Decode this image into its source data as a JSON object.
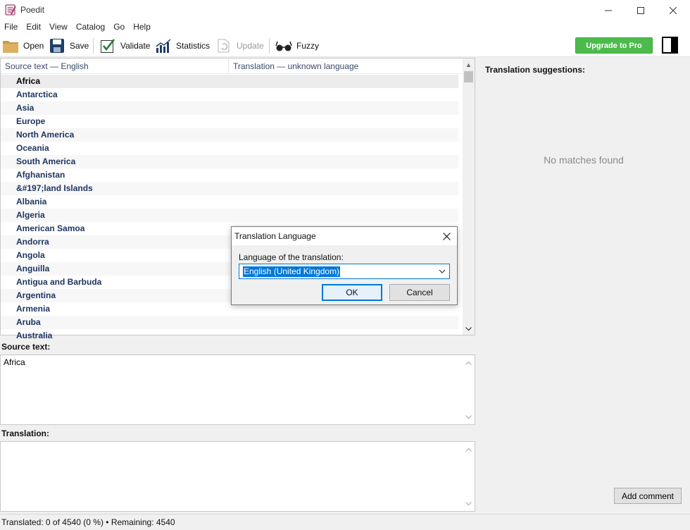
{
  "window": {
    "title": "Poedit"
  },
  "menu": [
    "File",
    "Edit",
    "View",
    "Catalog",
    "Go",
    "Help"
  ],
  "toolbar": {
    "open": "Open",
    "save": "Save",
    "validate": "Validate",
    "statistics": "Statistics",
    "update": "Update",
    "fuzzy": "Fuzzy",
    "upgrade": "Upgrade to Pro"
  },
  "list": {
    "col_source": "Source text — English",
    "col_translation": "Translation — unknown language",
    "rows": [
      "Africa",
      "Antarctica",
      "Asia",
      "Europe",
      "North America",
      "Oceania",
      "South America",
      "Afghanistan",
      "&#197;land Islands",
      "Albania",
      "Algeria",
      "American Samoa",
      "Andorra",
      "Angola",
      "Anguilla",
      "Antigua and Barbuda",
      "Argentina",
      "Armenia",
      "Aruba",
      "Australia"
    ],
    "selected_index": 0
  },
  "source_pane": {
    "label": "Source text:",
    "text": "Africa"
  },
  "translation_pane": {
    "label": "Translation:",
    "text": ""
  },
  "suggestions": {
    "title": "Translation suggestions:",
    "empty": "No matches found",
    "add_comment": "Add comment"
  },
  "status": "Translated: 0 of 4540 (0 %)  •  Remaining: 4540",
  "dialog": {
    "title": "Translation Language",
    "label": "Language of the translation:",
    "selected": "English (United Kingdom)",
    "ok": "OK",
    "cancel": "Cancel"
  },
  "colors": {
    "upgrade_bg": "#4cbb4c",
    "accent": "#0078d7",
    "row_text": "#1f3560"
  }
}
